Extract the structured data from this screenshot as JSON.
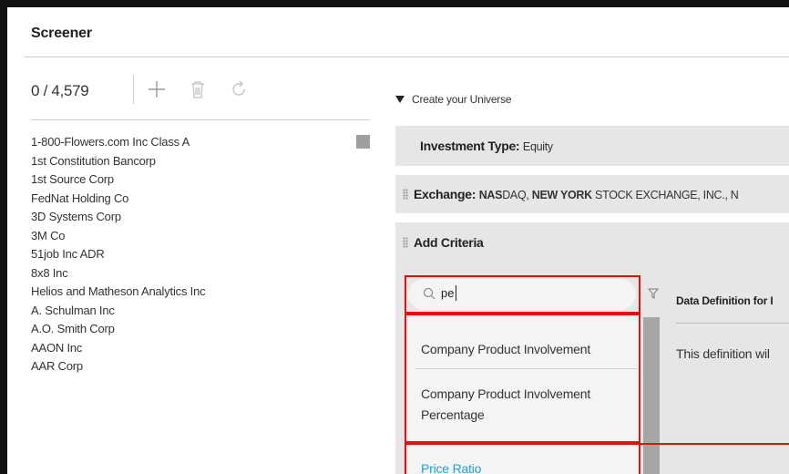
{
  "app": {
    "title": "Screener"
  },
  "toolbar": {
    "count": "0 / 4,579",
    "add_icon": "plus-icon",
    "delete_icon": "trash-icon",
    "refresh_icon": "refresh-icon"
  },
  "companies": [
    "1-800-Flowers.com Inc Class A",
    "1st Constitution Bancorp",
    "1st Source Corp",
    "FedNat Holding Co",
    "3D Systems Corp",
    "3M Co",
    "51job Inc ADR",
    "8x8 Inc",
    "Helios and Matheson Analytics Inc",
    "A. Schulman Inc",
    "A.O. Smith Corp",
    "AAON Inc",
    "AAR Corp"
  ],
  "universe": {
    "toggle_label": "Create your Universe",
    "investment_type": {
      "label": "Investment Type:",
      "value": "Equity"
    },
    "exchange": {
      "label": "Exchange:",
      "value_1": "NAS",
      "value_2": "DAQ, ",
      "value_3": "NEW YORK",
      "value_4": " STOCK EXCHANGE, INC., N"
    },
    "add_criteria": "Add Criteria"
  },
  "criteria_search": {
    "value": "pe",
    "results": [
      "Company Product Involvement",
      "Company Product Involvement Percentage",
      "Price Ratio"
    ],
    "selected_color": "#1aa3d9"
  },
  "definition": {
    "title": "Data Definition for I",
    "body": "This definition wil"
  },
  "colors": {
    "highlight": "#e01010",
    "band": "#e6e6e6"
  }
}
